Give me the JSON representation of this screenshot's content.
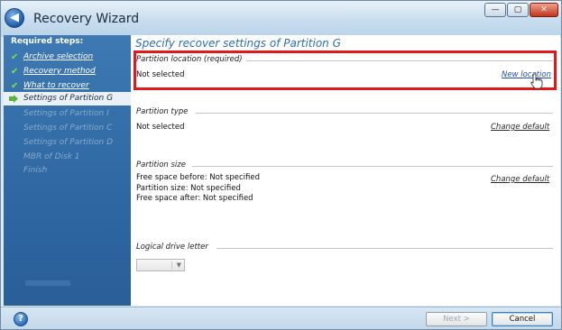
{
  "window": {
    "title": "Recovery Wizard",
    "controls": {
      "minimize": "—",
      "maximize": "▢",
      "close": "✕"
    }
  },
  "sidebar": {
    "header": "Required steps:",
    "items": [
      {
        "label": "Archive selection",
        "state": "done"
      },
      {
        "label": "Recovery method",
        "state": "done"
      },
      {
        "label": "What to recover",
        "state": "done"
      },
      {
        "label": "Settings of Partition G",
        "state": "active"
      },
      {
        "label": "Settings of Partition I",
        "state": "pending"
      },
      {
        "label": "Settings of Partition C",
        "state": "pending"
      },
      {
        "label": "Settings of Partition D",
        "state": "pending"
      },
      {
        "label": "MBR of Disk 1",
        "state": "pending"
      },
      {
        "label": "Finish",
        "state": "pending"
      }
    ]
  },
  "main": {
    "title": "Specify recover settings of Partition G",
    "partition_location": {
      "label": "Partition location (required)",
      "value": "Not selected",
      "action": "New location"
    },
    "partition_type": {
      "label": "Partition type",
      "value": "Not selected",
      "action": "Change default"
    },
    "partition_size": {
      "label": "Partition size",
      "lines": [
        "Free space before: Not specified",
        "Partition size: Not specified",
        "Free space after: Not specified"
      ],
      "action": "Change default"
    },
    "logical_drive": {
      "label": "Logical drive letter",
      "value": ""
    }
  },
  "footer": {
    "help": "?",
    "next_label": "Next >",
    "cancel_label": "Cancel"
  },
  "colors": {
    "highlight": "#e01a1a",
    "sidebar": "#2e67a2",
    "title_accent": "#2a6fb0"
  }
}
